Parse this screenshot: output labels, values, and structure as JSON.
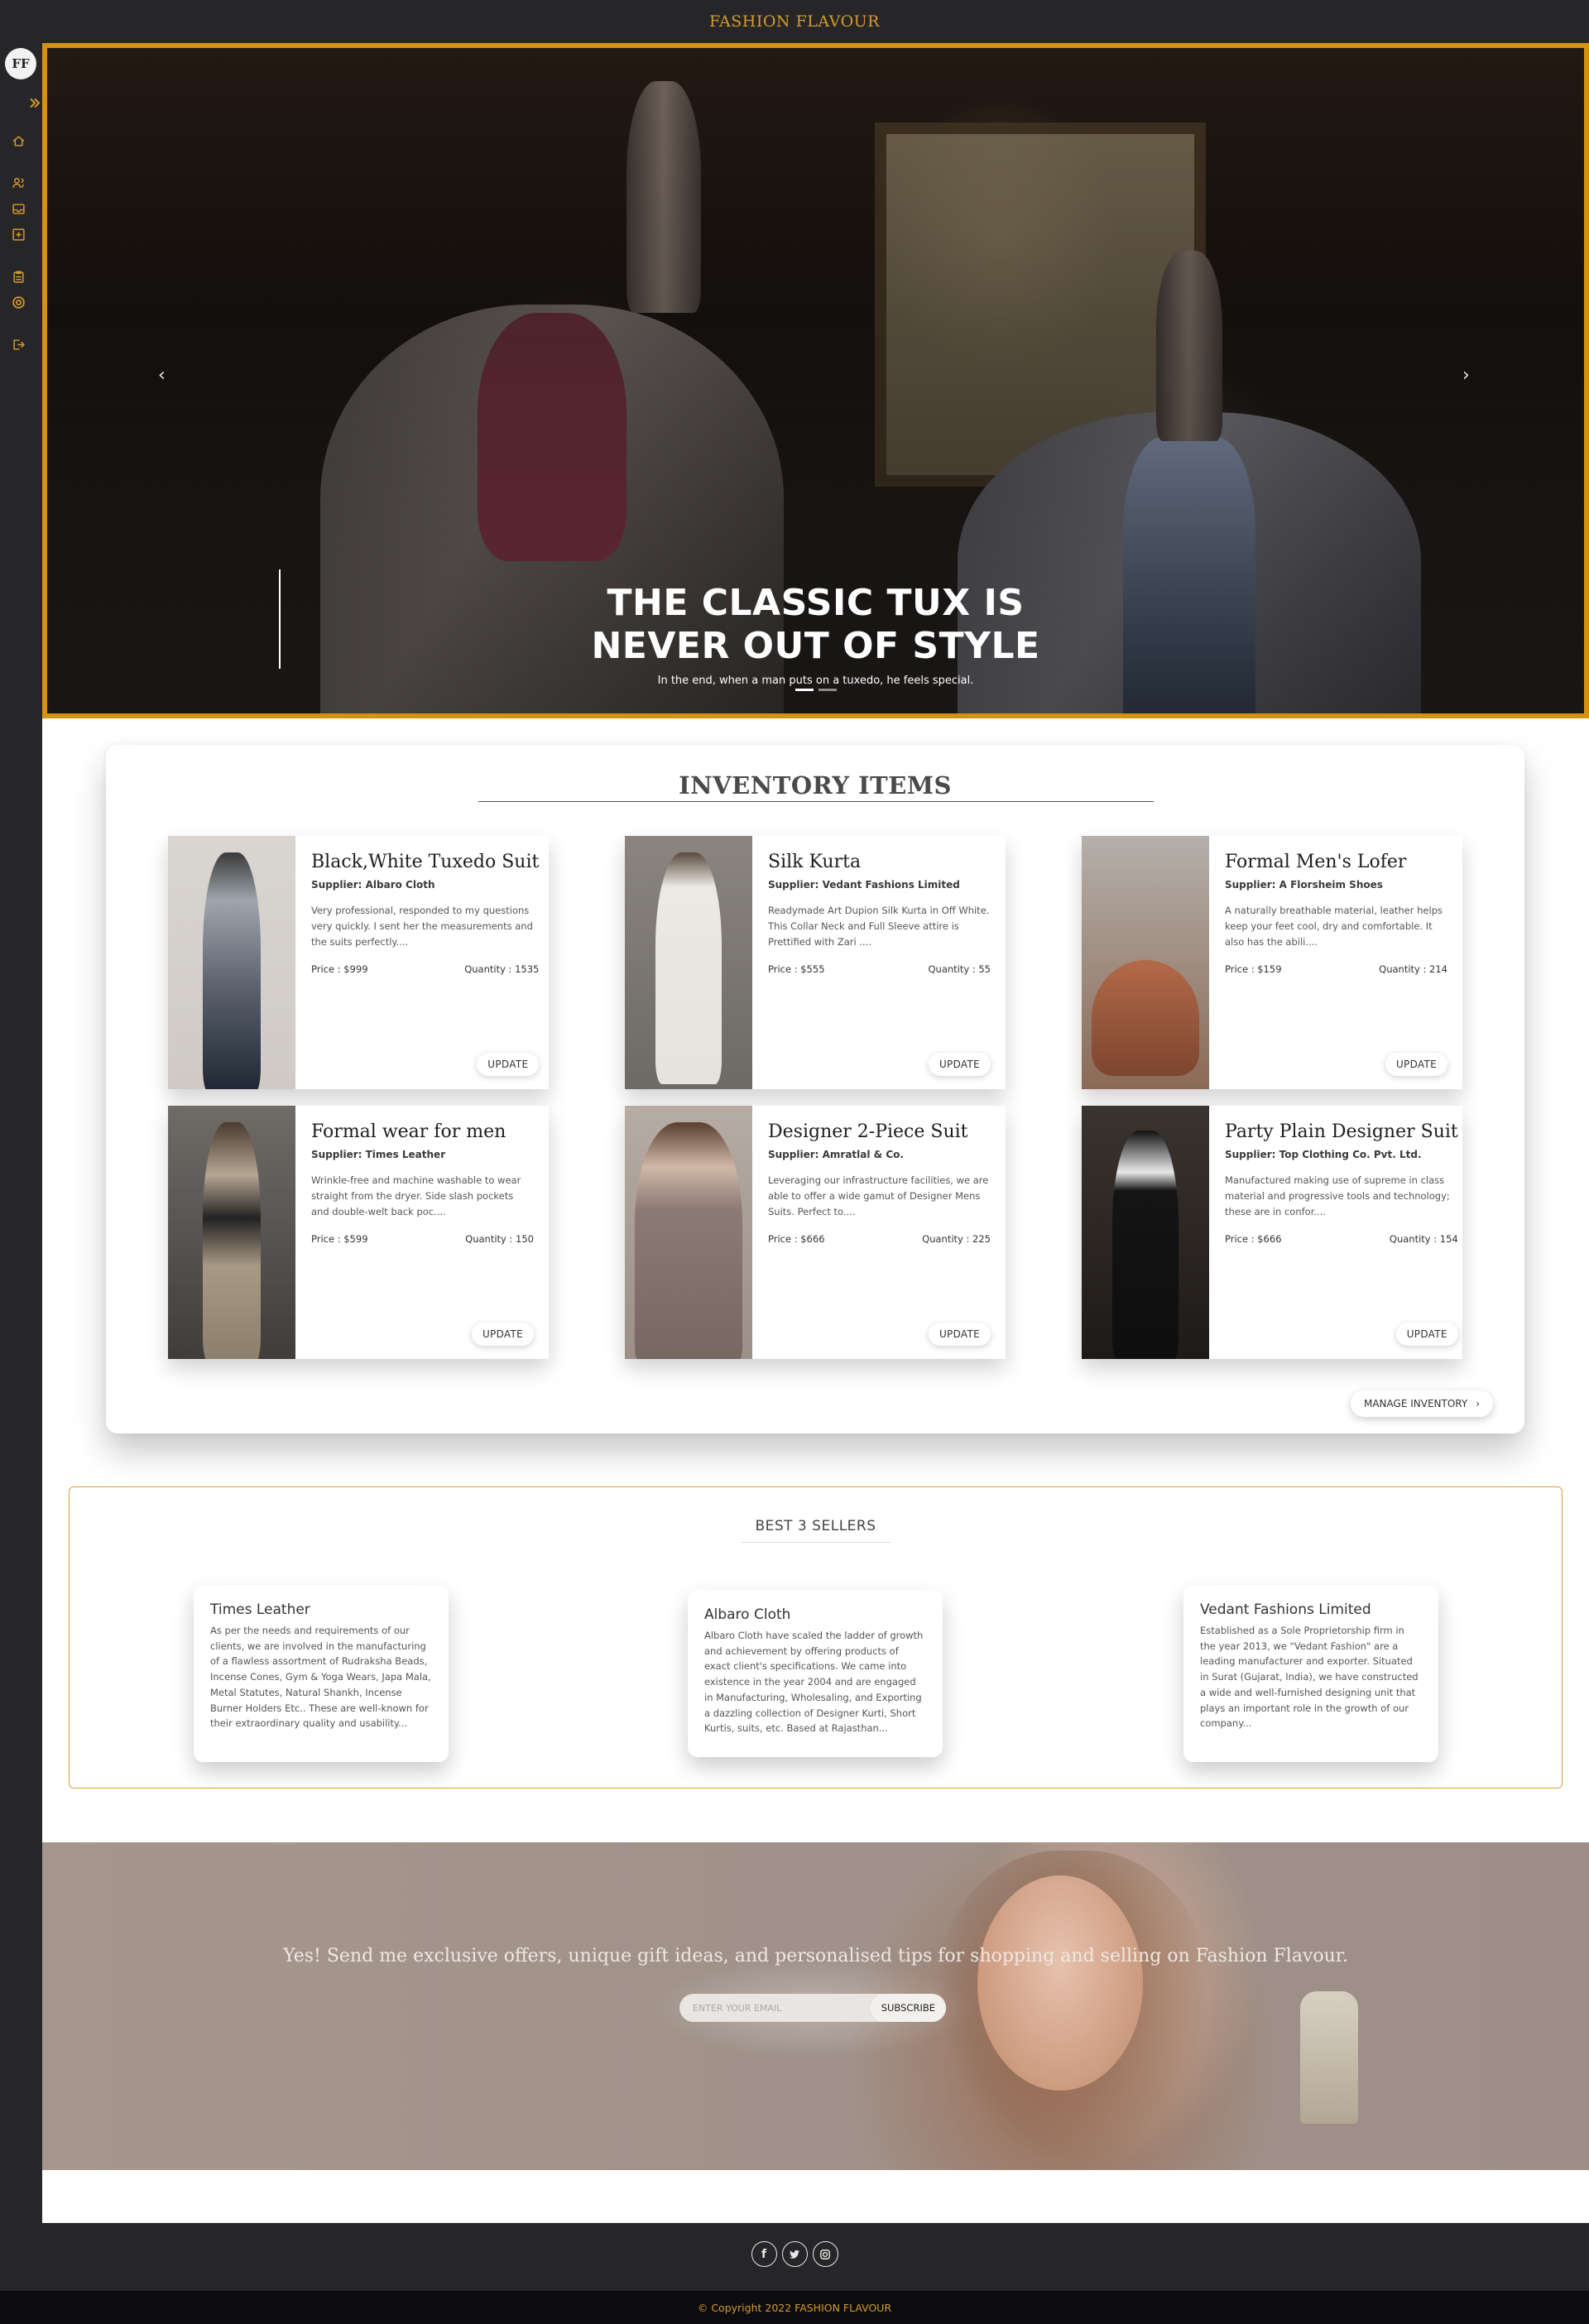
{
  "header": {
    "brand": "FASHION FLAVOUR"
  },
  "sidebar": {
    "logo_text": "FF",
    "icons": [
      "double-chevron-right-icon",
      "home-icon",
      "users-icon",
      "inbox-icon",
      "add-box-icon",
      "clipboard-icon",
      "target-icon",
      "logout-icon"
    ]
  },
  "hero": {
    "title_line1": "THE CLASSIC TUX IS",
    "title_line2": "NEVER OUT OF STYLE",
    "subtitle": "In the end, when a man puts on a tuxedo, he feels special.",
    "slide_count": 2,
    "active_slide": 1
  },
  "inventory": {
    "title": "INVENTORY ITEMS",
    "update_label": "UPDATE",
    "manage_label": "MANAGE INVENTORY",
    "items": [
      {
        "name": "Black,White Tuxedo Suit",
        "supplier": "Supplier: Albaro Cloth",
        "description": "Very professional, responded to my questions very quickly. I sent her the measurements and the suits perfectly....",
        "price": "Price : $999",
        "quantity": "Quantity : 1535"
      },
      {
        "name": "Silk Kurta",
        "supplier": "Supplier: Vedant Fashions Limited",
        "description": "Readymade Art Dupion Silk Kurta in Off White. This Collar Neck and Full Sleeve attire is Prettified with Zari ....",
        "price": "Price : $555",
        "quantity": "Quantity : 55"
      },
      {
        "name": "Formal Men's Lofer",
        "supplier": "Supplier: A Florsheim Shoes",
        "description": "A naturally breathable material, leather helps keep your feet cool, dry and comfortable. It also has the abili....",
        "price": "Price : $159",
        "quantity": "Quantity : 214"
      },
      {
        "name": "Formal wear for men",
        "supplier": "Supplier: Times Leather",
        "description": "Wrinkle-free and machine washable to wear straight from the dryer. Side slash pockets and double-welt back poc....",
        "price": "Price : $599",
        "quantity": "Quantity : 150"
      },
      {
        "name": "Designer 2-Piece Suit",
        "supplier": "Supplier: Amratlal & Co.",
        "description": "Leveraging our infrastructure facilities, we are able to offer a wide gamut of Designer Mens Suits. Perfect to....",
        "price": "Price : $666",
        "quantity": "Quantity : 225"
      },
      {
        "name": "Party Plain Designer Suit",
        "supplier": "Supplier: Top Clothing Co. Pvt. Ltd.",
        "description": "Manufactured making use of supreme in class material and progressive tools and technology; these are in confor....",
        "price": "Price : $666",
        "quantity": "Quantity : 154"
      }
    ]
  },
  "sellers": {
    "title": "BEST 3 SELLERS",
    "items": [
      {
        "name": "Times Leather",
        "description": "As per the needs and requirements of our clients, we are involved in the manufacturing of a flawless assortment of Rudraksha Beads, Incense Cones, Gym & Yoga Wears, Japa Mala, Metal Statutes, Natural Shankh, Incense Burner Holders Etc.. These are well-known for their extraordinary quality and usability..."
      },
      {
        "name": "Albaro Cloth",
        "description": "Albaro Cloth have scaled the ladder of growth and achievement by offering products of exact client's specifications. We came into existence in the year 2004 and are engaged in Manufacturing, Wholesaling, and Exporting a dazzling collection of Designer Kurti, Short Kurtis, suits, etc. Based at Rajasthan..."
      },
      {
        "name": "Vedant Fashions Limited",
        "description": "Established as a Sole Proprietorship firm in the year 2013, we \"Vedant Fashion\" are a leading manufacturer and exporter. Situated in Surat (Gujarat, India), we have constructed a wide and well-furnished designing unit that plays an important role in the growth of our company..."
      }
    ]
  },
  "newsletter": {
    "message": "Yes! Send me exclusive offers, unique gift ideas, and personalised tips for shopping and selling on Fashion Flavour.",
    "placeholder": "ENTER YOUR EMAIL",
    "subscribe_label": "SUBSCRIBE"
  },
  "footer": {
    "socials": [
      "facebook-icon",
      "twitter-icon",
      "instagram-icon"
    ],
    "copyright": "© Copyright 2022 FASHION FLAVOUR"
  },
  "colors": {
    "accent": "#d49b2c",
    "dark": "#262629",
    "hero_border": "#d4920f"
  }
}
